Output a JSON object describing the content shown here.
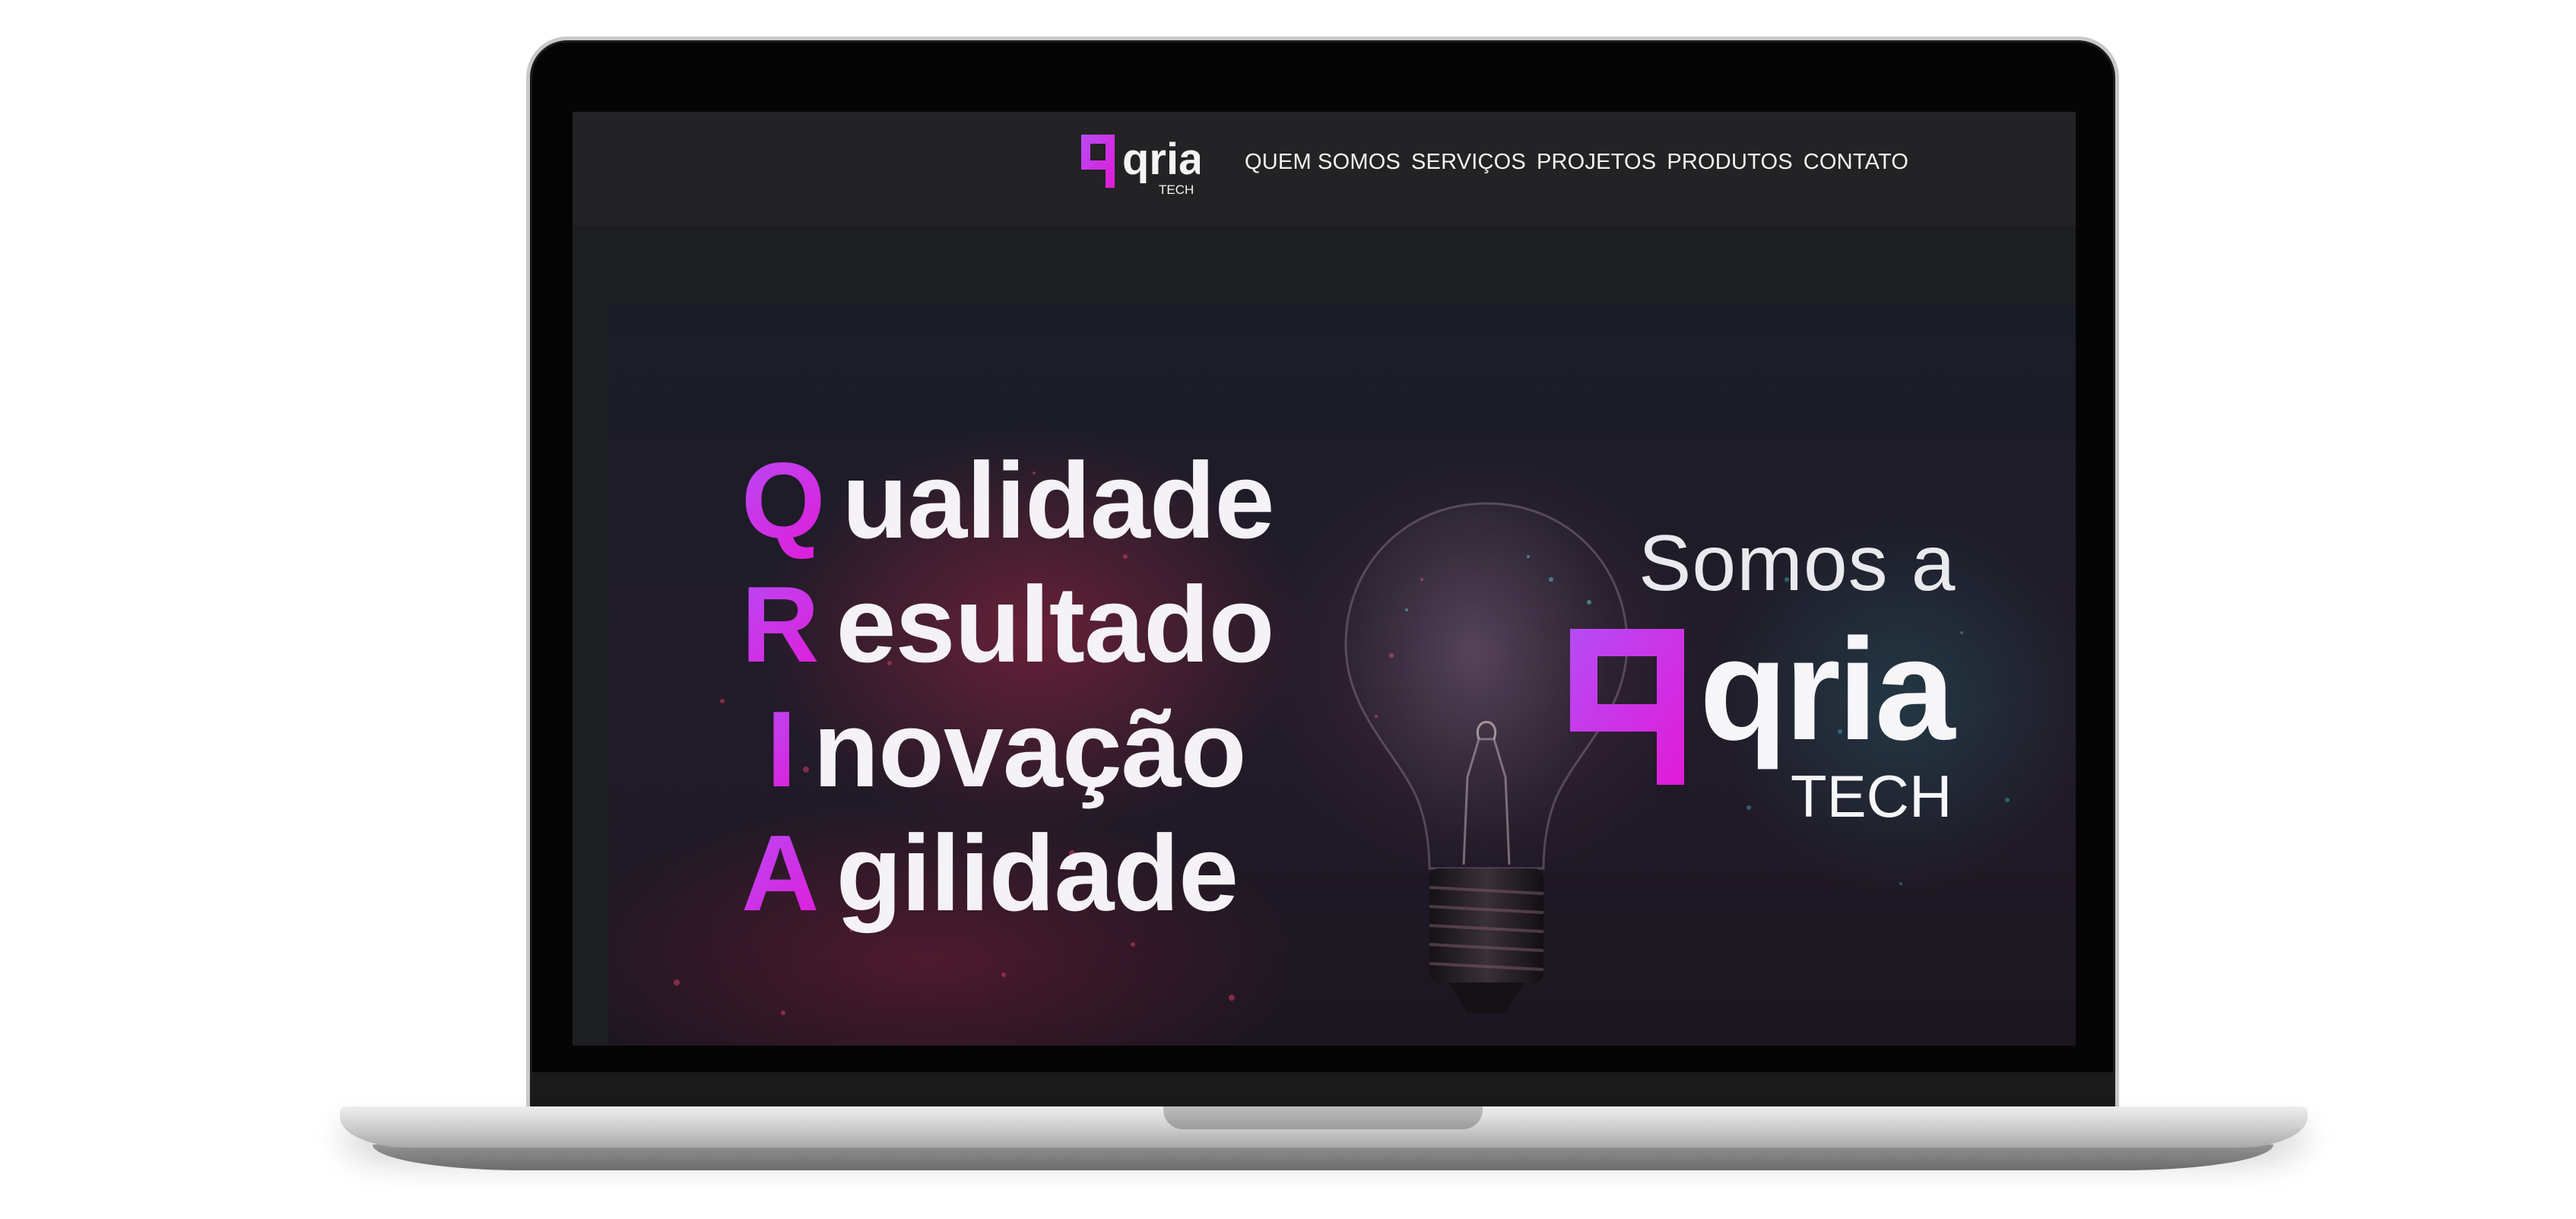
{
  "brand": {
    "logo_text": "qria",
    "logo_subtext": "TECH",
    "primary_purple": "#b64cf5",
    "primary_magenta": "#e21ad8"
  },
  "nav": {
    "items": [
      {
        "label": "QUEM SOMOS"
      },
      {
        "label": "SERVIÇOS"
      },
      {
        "label": "PROJETOS"
      },
      {
        "label": "PRODUTOS"
      },
      {
        "label": "CONTATO"
      }
    ]
  },
  "hero": {
    "acronym": [
      {
        "initial": "Q",
        "rest": "ualidade"
      },
      {
        "initial": "R",
        "rest": "esultado"
      },
      {
        "initial": "I",
        "rest": "novação"
      },
      {
        "initial": "A",
        "rest": "gilidade"
      }
    ],
    "tagline": "Somos a",
    "logo_text": "qria",
    "logo_subtext": "TECH",
    "image": "lightbulb-image"
  }
}
